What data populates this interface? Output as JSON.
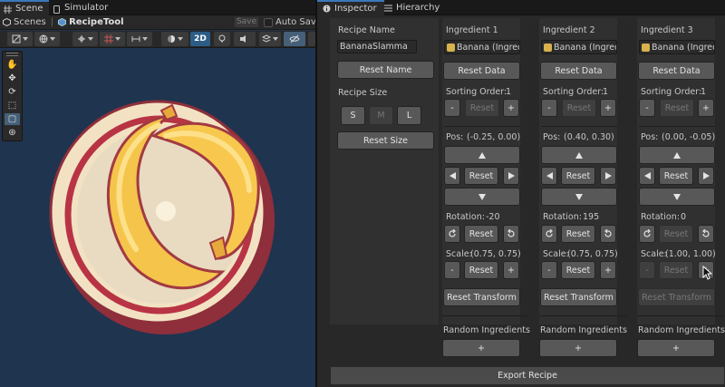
{
  "scene_window": {
    "tabs": [
      {
        "label": "Scene",
        "icon": "scene-hash-icon",
        "active": true
      },
      {
        "label": "Simulator",
        "icon": "simulator-icon",
        "active": false
      }
    ],
    "breadcrumb": [
      "Scenes",
      "RecipeTool"
    ],
    "save_label": "Save",
    "autosave_label": "Auto Save",
    "toolbar": {
      "mode_2d_label": "2D"
    },
    "colors": {
      "scene_background": "#1f344f"
    }
  },
  "inspector_window": {
    "tabs": [
      {
        "label": "Inspector",
        "icon": "info-icon",
        "active": true
      },
      {
        "label": "Hierarchy",
        "icon": "list-icon",
        "active": false
      }
    ]
  },
  "recipe": {
    "name_label": "Recipe Name",
    "name_value": "BananaSlamma",
    "reset_name_label": "Reset Name",
    "size_label": "Recipe Size",
    "size_options": [
      "S",
      "M",
      "L"
    ],
    "size_selected": "M",
    "reset_size_label": "Reset Size"
  },
  "ingredients": [
    {
      "title": "Ingredient 1",
      "object_value": "Banana (Ingred",
      "reset_data_label": "Reset Data",
      "sorting_label": "Sorting Order:",
      "sorting_value": "1",
      "minus": "-",
      "plus": "+",
      "reset": "Reset",
      "pos_label": "Pos:",
      "pos_value": "(-0.25, 0.00)",
      "rotation_label": "Rotation:",
      "rotation_value": "-20",
      "scale_label": "Scale:",
      "scale_value": "(0.75, 0.75)",
      "reset_transform_label": "Reset Transform",
      "transform_enabled": true,
      "scale_reset_enabled": true,
      "rotation_reset_enabled": true,
      "sorting_reset_enabled": false,
      "scale_minus_enabled": true
    },
    {
      "title": "Ingredient 2",
      "object_value": "Banana (Ingred",
      "reset_data_label": "Reset Data",
      "sorting_label": "Sorting Order:",
      "sorting_value": "1",
      "minus": "-",
      "plus": "+",
      "reset": "Reset",
      "pos_label": "Pos:",
      "pos_value": "(0.40, 0.30)",
      "rotation_label": "Rotation:",
      "rotation_value": "195",
      "scale_label": "Scale:",
      "scale_value": "(0.75, 0.75)",
      "reset_transform_label": "Reset Transform",
      "transform_enabled": true,
      "scale_reset_enabled": true,
      "rotation_reset_enabled": true,
      "sorting_reset_enabled": false,
      "scale_minus_enabled": true
    },
    {
      "title": "Ingredient 3",
      "object_value": "Banana (Ingred",
      "reset_data_label": "Reset Data",
      "sorting_label": "Sorting Order:",
      "sorting_value": "1",
      "minus": "-",
      "plus": "+",
      "reset": "Reset",
      "pos_label": "Pos:",
      "pos_value": "(0.00, -0.05)",
      "rotation_label": "Rotation:",
      "rotation_value": "0",
      "scale_label": "Scale:",
      "scale_value": "(1.00, 1.00)",
      "reset_transform_label": "Reset Transform",
      "transform_enabled": false,
      "scale_reset_enabled": false,
      "rotation_reset_enabled": false,
      "sorting_reset_enabled": false,
      "scale_minus_enabled": false
    }
  ],
  "random_ingredients": [
    {
      "label": "Random Ingredients",
      "button": "+"
    },
    {
      "label": "Random Ingredients",
      "button": "+"
    },
    {
      "label": "Random Ingredients",
      "button": "+"
    }
  ],
  "export_label": "Export Recipe"
}
